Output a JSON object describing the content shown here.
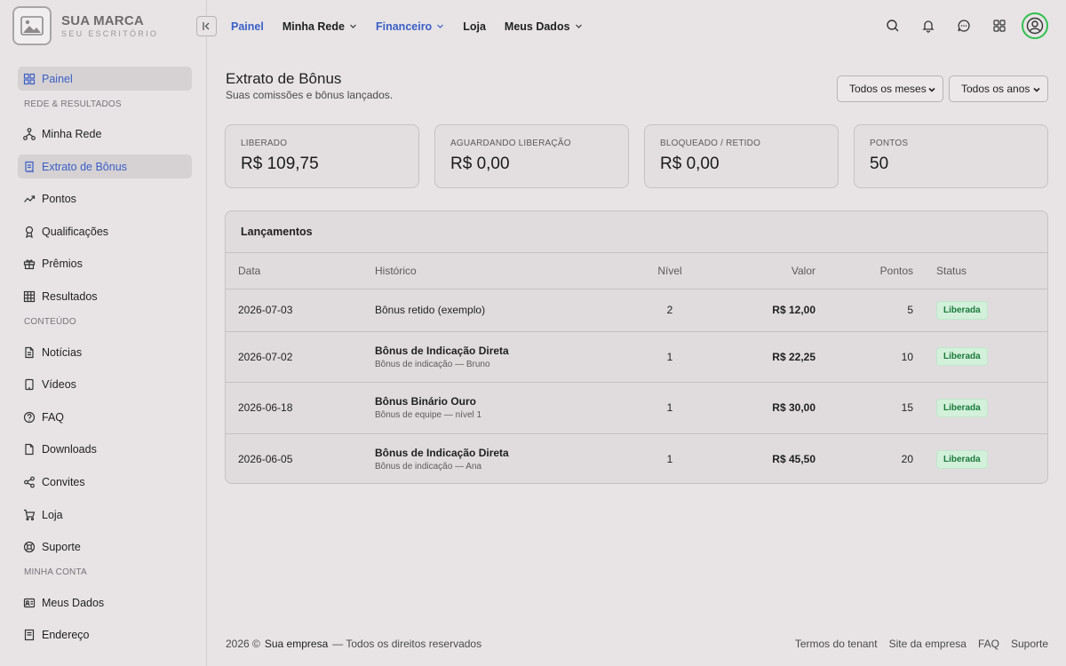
{
  "brand": {
    "name": "SUA MARCA",
    "subtitle": "SEU ESCRITÓRIO"
  },
  "sidebar": {
    "items": [
      {
        "label": "Painel",
        "icon": "grid-icon",
        "active": true
      },
      {
        "section": "REDE & RESULTADOS"
      },
      {
        "label": "Minha Rede",
        "icon": "network-icon"
      },
      {
        "label": "Extrato de Bônus",
        "icon": "receipt-icon",
        "active": true
      },
      {
        "label": "Pontos",
        "icon": "trend-icon"
      },
      {
        "label": "Qualificações",
        "icon": "award-icon"
      },
      {
        "label": "Prêmios",
        "icon": "gift-icon"
      },
      {
        "label": "Resultados",
        "icon": "table-icon"
      },
      {
        "section": "CONTEÚDO"
      },
      {
        "label": "Notícias",
        "icon": "document-icon"
      },
      {
        "label": "Vídeos",
        "icon": "tablet-icon"
      },
      {
        "label": "FAQ",
        "icon": "question-icon"
      },
      {
        "label": "Downloads",
        "icon": "file-icon"
      },
      {
        "label": "Convites",
        "icon": "share-icon"
      },
      {
        "label": "Loja",
        "icon": "cart-icon"
      },
      {
        "label": "Suporte",
        "icon": "support-icon"
      },
      {
        "section": "MINHA CONTA"
      },
      {
        "label": "Meus Dados",
        "icon": "id-card-icon"
      },
      {
        "label": "Endereço",
        "icon": "address-icon"
      }
    ]
  },
  "topnav": {
    "items": [
      {
        "label": "Painel",
        "color": "#3a5fc8",
        "dropdown": false
      },
      {
        "label": "Minha Rede",
        "dropdown": true
      },
      {
        "label": "Financeiro",
        "color": "#3a5fc8",
        "dropdown": true
      },
      {
        "label": "Loja",
        "dropdown": false
      },
      {
        "label": "Meus Dados",
        "dropdown": true
      }
    ],
    "icons": [
      "search-icon",
      "bell-icon",
      "chat-icon",
      "apps-icon"
    ],
    "avatar_ring_color": "#2fbf4f"
  },
  "page": {
    "title": "Extrato de Bônus",
    "subtitle": "Suas comissões e bônus lançados.",
    "filter_month": "Todos os meses",
    "filter_year": "Todos os anos"
  },
  "cards": [
    {
      "label": "LIBERADO",
      "value": "R$ 109,75"
    },
    {
      "label": "AGUARDANDO LIBERAÇÃO",
      "value": "R$ 0,00"
    },
    {
      "label": "BLOQUEADO / RETIDO",
      "value": "R$ 0,00"
    },
    {
      "label": "PONTOS",
      "value": "50"
    }
  ],
  "table": {
    "title": "Lançamentos",
    "columns": [
      "Data",
      "Histórico",
      "Nível",
      "Valor",
      "Pontos",
      "Status"
    ],
    "rows": [
      {
        "date": "2026-07-03",
        "title": "Bônus retido (exemplo)",
        "sub": "",
        "nivel": "2",
        "valor": "R$ 12,00",
        "pontos": "5",
        "status": "Liberada"
      },
      {
        "date": "2026-07-02",
        "title": "Bônus de Indicação Direta",
        "sub": "Bônus de indicação — Bruno",
        "nivel": "1",
        "valor": "R$ 22,25",
        "pontos": "10",
        "status": "Liberada"
      },
      {
        "date": "2026-06-18",
        "title": "Bônus Binário Ouro",
        "sub": "Bônus de equipe — nível 1",
        "nivel": "1",
        "valor": "R$ 30,00",
        "pontos": "15",
        "status": "Liberada"
      },
      {
        "date": "2026-06-05",
        "title": "Bônus de Indicação Direta",
        "sub": "Bônus de indicação — Ana",
        "nivel": "1",
        "valor": "R$ 45,50",
        "pontos": "20",
        "status": "Liberada"
      }
    ]
  },
  "footer": {
    "year": "2026 ©",
    "company": "Sua empresa",
    "rights": "— Todos os direitos reservados",
    "links": [
      "Termos do tenant",
      "Site da empresa",
      "FAQ",
      "Suporte"
    ]
  }
}
